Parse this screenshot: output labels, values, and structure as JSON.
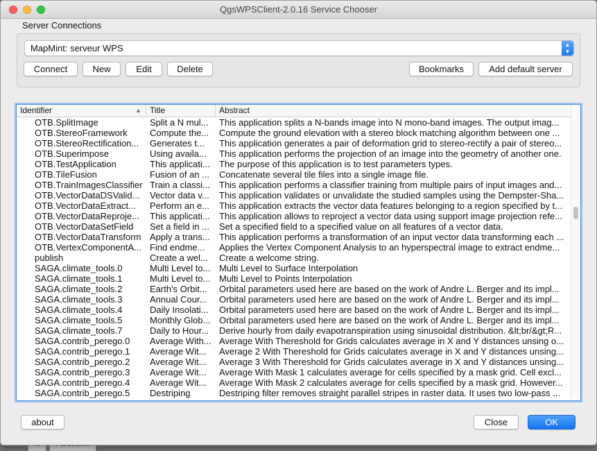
{
  "window": {
    "title": "QgsWPSClient-2.0.16 Service Chooser"
  },
  "server_connections": {
    "label": "Server Connections",
    "selected_server": "MapMint: serveur WPS",
    "buttons": {
      "connect": "Connect",
      "new": "New",
      "edit": "Edit",
      "delete": "Delete",
      "bookmarks": "Bookmarks",
      "add_default": "Add default server"
    }
  },
  "table": {
    "columns": [
      "Identifier",
      "Title",
      "Abstract"
    ],
    "sorted_column": "Identifier",
    "rows": [
      {
        "id": "OTB.SplitImage",
        "title": "Split a N mul...",
        "abstract": "This application splits a N-bands image into N mono-band images. The output imag..."
      },
      {
        "id": "OTB.StereoFramework",
        "title": "Compute the...",
        "abstract": "Compute the ground elevation with a stereo block matching algorithm between one ..."
      },
      {
        "id": "OTB.StereoRectification...",
        "title": "Generates t...",
        "abstract": "This application generates a pair of deformation grid to stereo-rectify a pair of stereo..."
      },
      {
        "id": "OTB.Superimpose",
        "title": "Using availa...",
        "abstract": "This application performs the projection of an image into the geometry of another one."
      },
      {
        "id": "OTB.TestApplication",
        "title": "This applicati...",
        "abstract": "The purpose of this application is to test parameters types."
      },
      {
        "id": "OTB.TileFusion",
        "title": "Fusion of an ...",
        "abstract": "Concatenate several tile files into a single image file."
      },
      {
        "id": "OTB.TrainImagesClassifier",
        "title": "Train a classi...",
        "abstract": "This application performs a classifier training from multiple pairs of input images and..."
      },
      {
        "id": "OTB.VectorDataDSValid...",
        "title": "Vector data v...",
        "abstract": "This application validates or unvalidate the studied samples using the Dempster-Sha..."
      },
      {
        "id": "OTB.VectorDataExtract...",
        "title": "Perform an e...",
        "abstract": "This application extracts the vector data features belonging to a region specified by t..."
      },
      {
        "id": "OTB.VectorDataReproje...",
        "title": "This applicati...",
        "abstract": "This application allows to reproject a vector data using support image projection refe..."
      },
      {
        "id": "OTB.VectorDataSetField",
        "title": "Set a field in ...",
        "abstract": "Set a specified field to a specified value on all features of a vector data."
      },
      {
        "id": "OTB.VectorDataTransform",
        "title": "Apply a trans...",
        "abstract": "This application performs a transformation of an input vector data transforming each ..."
      },
      {
        "id": "OTB.VertexComponentA...",
        "title": "Find endme...",
        "abstract": "Applies the Vertex Component Analysis to an hyperspectral image to extract endme..."
      },
      {
        "id": "publish",
        "title": "Create a wel...",
        "abstract": "Create a welcome string."
      },
      {
        "id": "SAGA.climate_tools.0",
        "title": "Multi Level to...",
        "abstract": "Multi Level to Surface Interpolation"
      },
      {
        "id": "SAGA.climate_tools.1",
        "title": "Multi Level to...",
        "abstract": "Multi Level to Points Interpolation"
      },
      {
        "id": "SAGA.climate_tools.2",
        "title": "Earth's Orbit...",
        "abstract": "Orbital parameters used here are based on the work of Andre L. Berger and its impl..."
      },
      {
        "id": "SAGA.climate_tools.3",
        "title": "Annual Cour...",
        "abstract": "Orbital parameters used here are based on the work of Andre L. Berger and its impl..."
      },
      {
        "id": "SAGA.climate_tools.4",
        "title": "Daily Insolati...",
        "abstract": "Orbital parameters used here are based on the work of Andre L. Berger and its impl..."
      },
      {
        "id": "SAGA.climate_tools.5",
        "title": "Monthly Glob...",
        "abstract": "Orbital parameters used here are based on the work of Andre L. Berger and its impl..."
      },
      {
        "id": "SAGA.climate_tools.7",
        "title": "Daily to Hour...",
        "abstract": "Derive hourly from daily evapotranspiration using sinusoidal distribution. &lt;br/&gt;R..."
      },
      {
        "id": "SAGA.contrib_perego.0",
        "title": "Average With...",
        "abstract": "Average With Thereshold for Grids calculates average in X and Y distances unsing o..."
      },
      {
        "id": "SAGA.contrib_perego.1",
        "title": "Average Wit...",
        "abstract": "Average 2 With Thereshold for Grids calculates average in X and Y distances unsing..."
      },
      {
        "id": "SAGA.contrib_perego.2",
        "title": "Average Wit...",
        "abstract": "Average 3 With Thereshold for Grids calculates average in X and Y distances unsing..."
      },
      {
        "id": "SAGA.contrib_perego.3",
        "title": "Average Wit...",
        "abstract": "Average With Mask 1 calculates average for cells specified by a mask grid. Cell excl..."
      },
      {
        "id": "SAGA.contrib_perego.4",
        "title": "Average Wit...",
        "abstract": "Average With Mask 2 calculates average for cells specified by a mask grid. However..."
      },
      {
        "id": "SAGA.contrib_perego.5",
        "title": "Destriping",
        "abstract": "Destriping filter removes straight parallel stripes in raster data. It uses two low-pass ..."
      }
    ]
  },
  "footer": {
    "about": "about",
    "close": "Close",
    "ok": "OK"
  },
  "background_tabs": [
    "...",
    "Parcouri..."
  ],
  "colors": {
    "accent": "#1f78f0",
    "selection_border": "#4a90e2"
  }
}
